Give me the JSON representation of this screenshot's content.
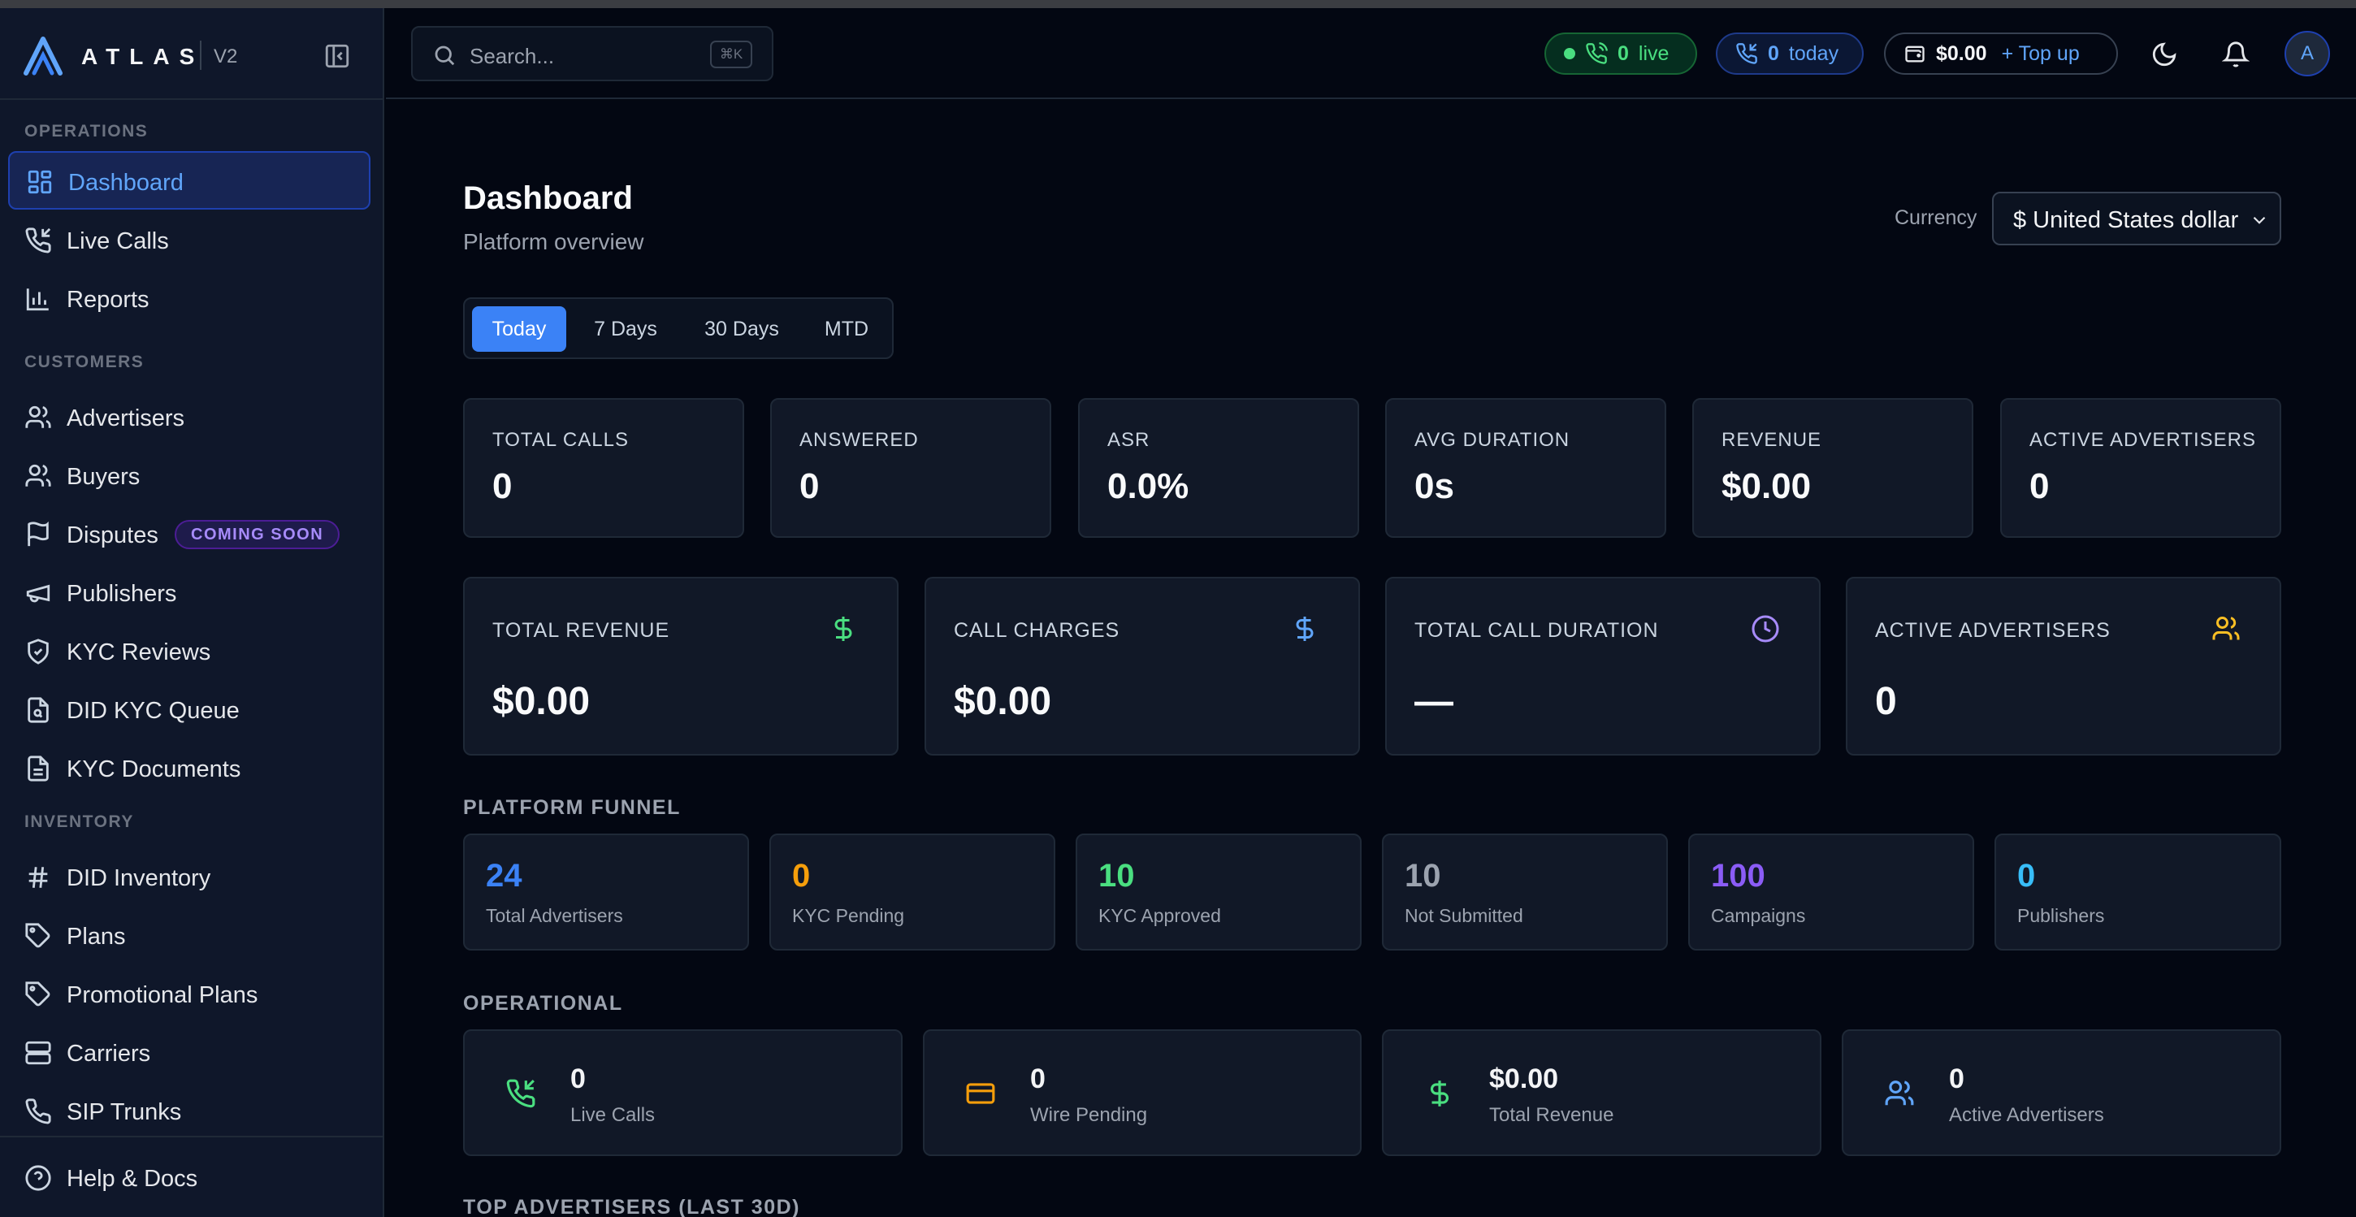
{
  "app": {
    "name": "ATLAS",
    "version": "V2"
  },
  "sidebar": {
    "sections": [
      {
        "title": "OPERATIONS",
        "items": [
          {
            "label": "Dashboard",
            "icon": "grid-icon",
            "active": true
          },
          {
            "label": "Live Calls",
            "icon": "phone-incoming-icon"
          },
          {
            "label": "Reports",
            "icon": "bar-chart-icon"
          }
        ]
      },
      {
        "title": "CUSTOMERS",
        "items": [
          {
            "label": "Advertisers",
            "icon": "users-icon"
          },
          {
            "label": "Buyers",
            "icon": "users-icon"
          },
          {
            "label": "Disputes",
            "icon": "flag-icon",
            "badge": "COMING SOON"
          },
          {
            "label": "Publishers",
            "icon": "megaphone-icon"
          },
          {
            "label": "KYC Reviews",
            "icon": "shield-check-icon"
          },
          {
            "label": "DID KYC Queue",
            "icon": "file-search-icon"
          },
          {
            "label": "KYC Documents",
            "icon": "file-text-icon"
          }
        ]
      },
      {
        "title": "INVENTORY",
        "items": [
          {
            "label": "DID Inventory",
            "icon": "hash-icon"
          },
          {
            "label": "Plans",
            "icon": "tag-icon"
          },
          {
            "label": "Promotional Plans",
            "icon": "tag-icon"
          },
          {
            "label": "Carriers",
            "icon": "server-icon"
          },
          {
            "label": "SIP Trunks",
            "icon": "phone-icon"
          }
        ]
      }
    ],
    "footer": {
      "label": "Help & Docs",
      "icon": "help-circle-icon"
    }
  },
  "header": {
    "search_placeholder": "Search...",
    "search_shortcut": "⌘K",
    "live_count": "0",
    "live_label": "live",
    "today_count": "0",
    "today_label": "today",
    "balance": "$0.00",
    "topup_label": "+ Top up",
    "avatar_initial": "A"
  },
  "page": {
    "title": "Dashboard",
    "subtitle": "Platform overview",
    "currency_label": "Currency",
    "currency_value": "$ United States dollar",
    "ranges": [
      "Today",
      "7 Days",
      "30 Days",
      "MTD"
    ],
    "active_range": "Today"
  },
  "stats": [
    {
      "label": "TOTAL CALLS",
      "value": "0"
    },
    {
      "label": "ANSWERED",
      "value": "0"
    },
    {
      "label": "ASR",
      "value": "0.0%"
    },
    {
      "label": "AVG DURATION",
      "value": "0s"
    },
    {
      "label": "REVENUE",
      "value": "$0.00"
    },
    {
      "label": "ACTIVE ADVERTISERS",
      "value": "0"
    }
  ],
  "big_cards": [
    {
      "label": "TOTAL REVENUE",
      "value": "$0.00",
      "icon": "dollar-icon",
      "color": "#4ade80"
    },
    {
      "label": "CALL CHARGES",
      "value": "$0.00",
      "icon": "dollar-icon",
      "color": "#60a5fa"
    },
    {
      "label": "TOTAL CALL DURATION",
      "value": "—",
      "icon": "clock-icon",
      "color": "#a78bfa"
    },
    {
      "label": "ACTIVE ADVERTISERS",
      "value": "0",
      "icon": "users-icon",
      "color": "#fbbf24"
    }
  ],
  "funnel": {
    "title": "PLATFORM FUNNEL",
    "items": [
      {
        "value": "24",
        "label": "Total Advertisers",
        "color": "#3b82f6"
      },
      {
        "value": "0",
        "label": "KYC Pending",
        "color": "#f59e0b"
      },
      {
        "value": "10",
        "label": "KYC Approved",
        "color": "#4ade80"
      },
      {
        "value": "10",
        "label": "Not Submitted",
        "color": "#9ca3af"
      },
      {
        "value": "100",
        "label": "Campaigns",
        "color": "#8b5cf6"
      },
      {
        "value": "0",
        "label": "Publishers",
        "color": "#38bdf8"
      }
    ]
  },
  "operational": {
    "title": "OPERATIONAL",
    "items": [
      {
        "value": "0",
        "label": "Live Calls",
        "icon": "phone-incoming-icon",
        "color": "#4ade80"
      },
      {
        "value": "0",
        "label": "Wire Pending",
        "icon": "credit-card-icon",
        "color": "#f59e0b"
      },
      {
        "value": "$0.00",
        "label": "Total Revenue",
        "icon": "dollar-icon",
        "color": "#4ade80"
      },
      {
        "value": "0",
        "label": "Active Advertisers",
        "icon": "users-icon",
        "color": "#60a5fa"
      }
    ]
  },
  "next_section_title": "TOP ADVERTISERS (LAST 30D)"
}
